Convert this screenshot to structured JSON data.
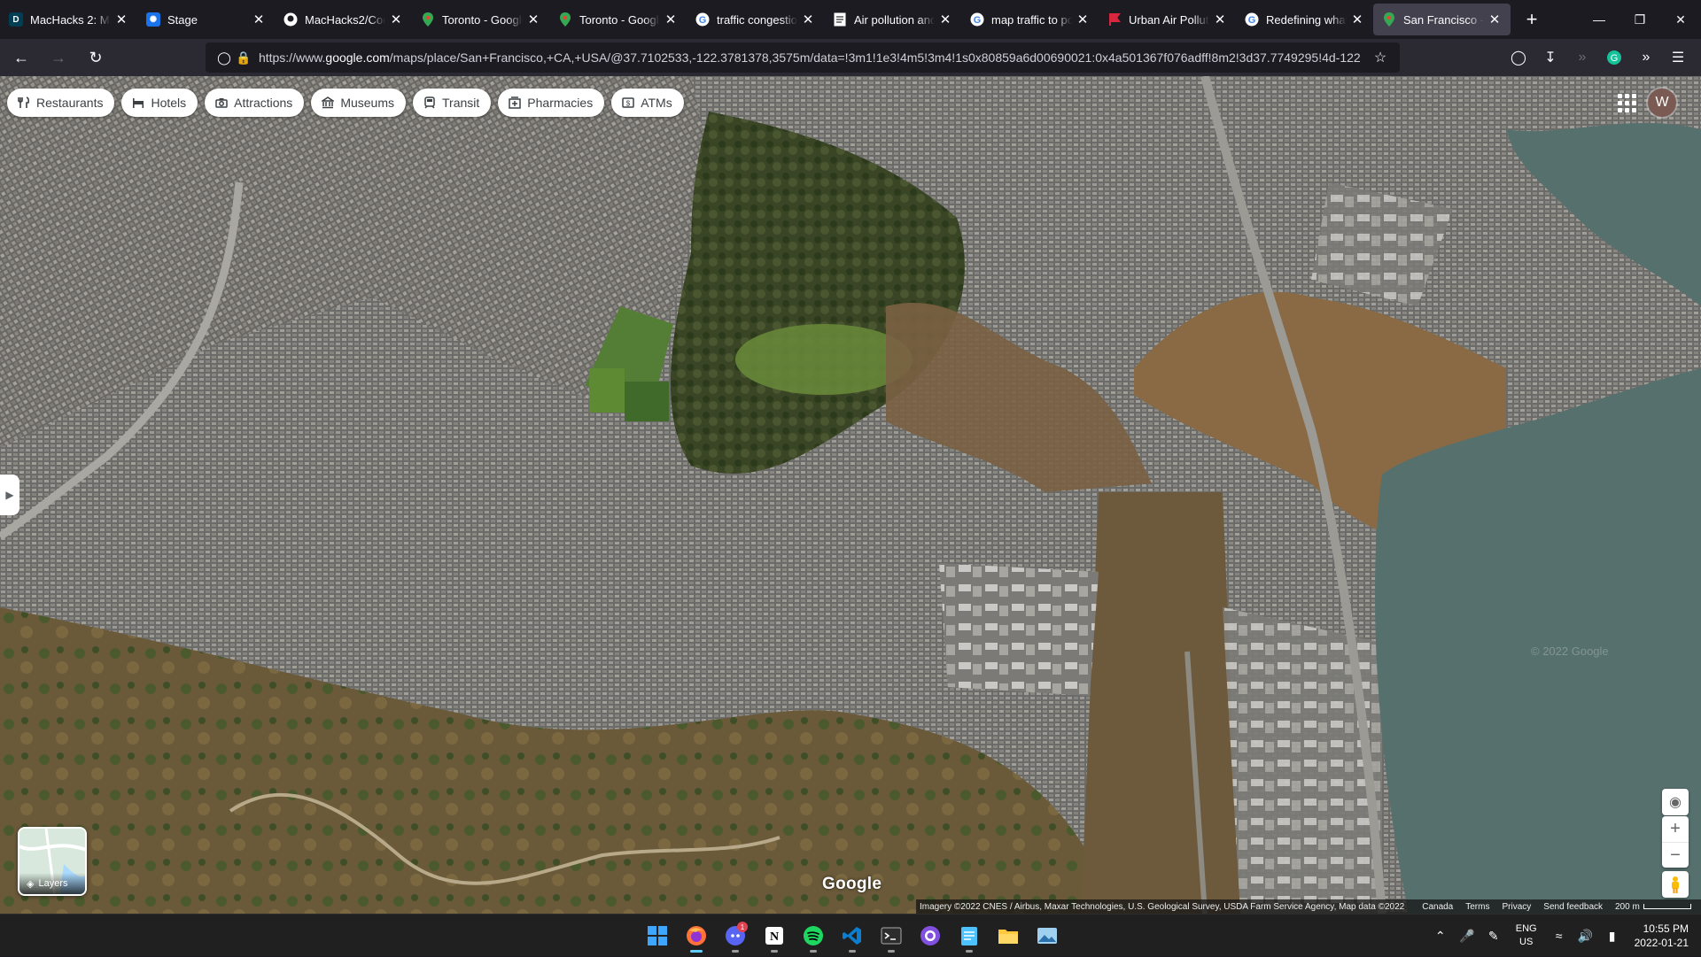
{
  "browser": {
    "tabs": [
      {
        "title": "MacHacks 2: Mac",
        "favicon": "devpost-icon",
        "color": "#003e54",
        "letter": "D"
      },
      {
        "title": "Stage",
        "favicon": "stage-icon",
        "color": "#1a73e8",
        "letter": "✺"
      },
      {
        "title": "MacHacks2/Code",
        "favicon": "github-icon",
        "color": "#ffffff",
        "letter": ""
      },
      {
        "title": "Toronto - Google",
        "favicon": "maps-pin-icon",
        "color": "#34a853",
        "letter": ""
      },
      {
        "title": "Toronto - Google",
        "favicon": "maps-pin-icon",
        "color": "#34a853",
        "letter": ""
      },
      {
        "title": "traffic congestion",
        "favicon": "google-icon",
        "color": "#ffffff",
        "letter": "G"
      },
      {
        "title": "Air pollution and",
        "favicon": "document-icon",
        "color": "#ffffff",
        "letter": ""
      },
      {
        "title": "map traffic to poll",
        "favicon": "google-icon",
        "color": "#ffffff",
        "letter": "G"
      },
      {
        "title": "Urban Air Pollutio",
        "favicon": "flag-icon",
        "color": "#d7263d",
        "letter": ""
      },
      {
        "title": "Redefining what a",
        "favicon": "google-icon",
        "color": "#ffffff",
        "letter": "G"
      },
      {
        "title": "San Francisco - Go",
        "favicon": "maps-pin-icon",
        "color": "#34a853",
        "letter": "",
        "active": true
      }
    ],
    "url_prefix": "https://www.",
    "url_host": "google.com",
    "url_rest": "/maps/place/San+Francisco,+CA,+USA/@37.7102533,-122.3781378,3575m/data=!3m1!1e3!4m5!3m4!1s0x80859a6d00690021:0x4a501367f076adff!8m2!3d37.7749295!4d-122"
  },
  "map": {
    "categories": [
      {
        "label": "Restaurants",
        "icon": "fork-knife-icon"
      },
      {
        "label": "Hotels",
        "icon": "bed-icon"
      },
      {
        "label": "Attractions",
        "icon": "camera-icon"
      },
      {
        "label": "Museums",
        "icon": "museum-icon"
      },
      {
        "label": "Transit",
        "icon": "train-icon"
      },
      {
        "label": "Pharmacies",
        "icon": "pharmacy-icon"
      },
      {
        "label": "ATMs",
        "icon": "atm-icon"
      }
    ],
    "avatar_letter": "W",
    "layers_label": "Layers",
    "logo": "Google",
    "watermark": "© 2022 Google",
    "attribution": "Imagery ©2022 CNES / Airbus, Maxar Technologies, U.S. Geological Survey, USDA Farm Service Agency, Map data ©2022",
    "links": [
      "Canada",
      "Terms",
      "Privacy",
      "Send feedback"
    ],
    "scale": "200 m"
  },
  "taskbar": {
    "apps": [
      "windows-start-icon",
      "firefox-icon",
      "discord-icon",
      "notion-icon",
      "spotify-icon",
      "vscode-icon",
      "terminal-icon",
      "github-desktop-icon",
      "notepad-icon",
      "file-explorer-icon",
      "photos-icon"
    ],
    "discord_badge": "1",
    "lang_top": "ENG",
    "lang_bottom": "US",
    "time": "10:55 PM",
    "date": "2022-01-21"
  }
}
